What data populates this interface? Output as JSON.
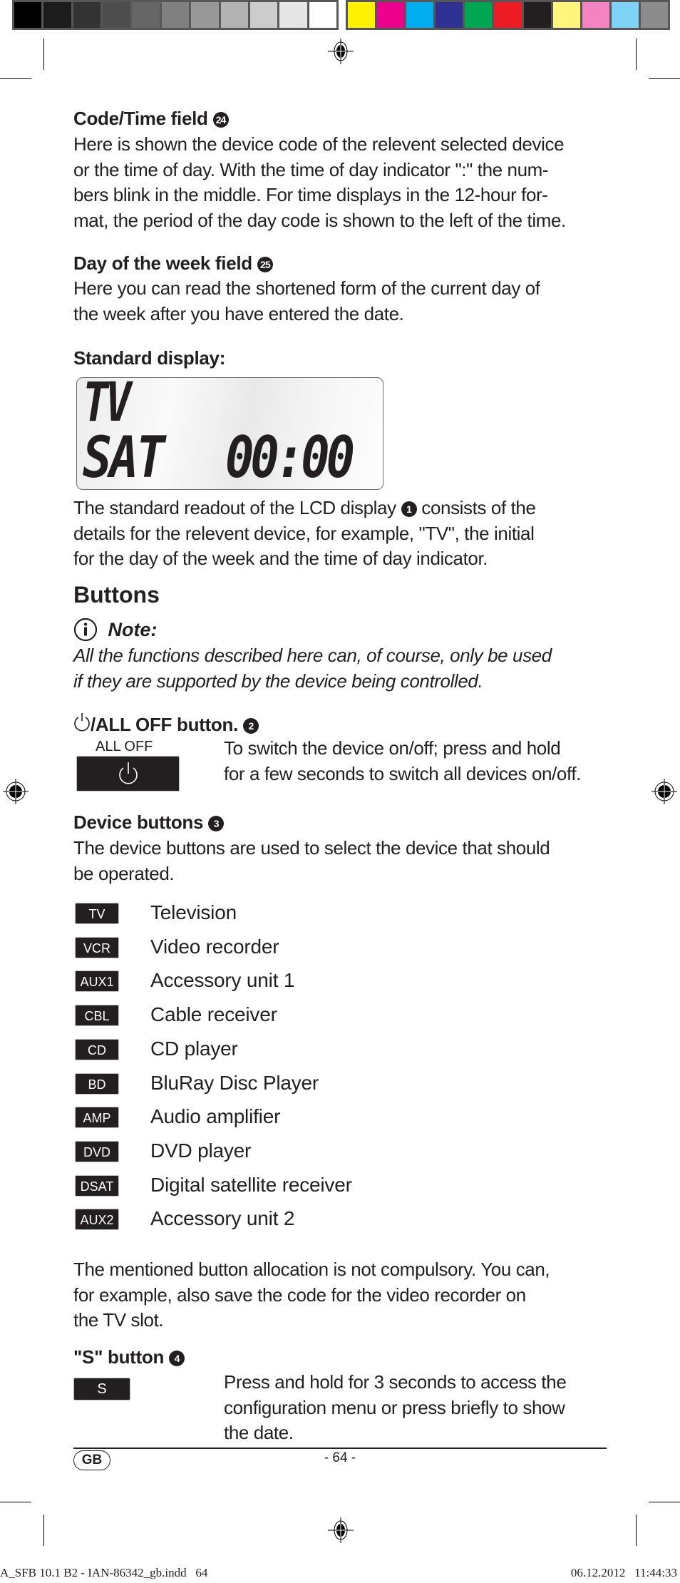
{
  "print_marks": {
    "grayscale_swatches": [
      "#000000",
      "#1c1c1c",
      "#333333",
      "#4d4d4d",
      "#666666",
      "#808080",
      "#999999",
      "#b3b3b3",
      "#cccccc",
      "#e6e6e6",
      "#ffffff"
    ],
    "color_swatches": [
      "#fff200",
      "#ec008c",
      "#00aeef",
      "#2e3192",
      "#00a651",
      "#ed1c24",
      "#231f20",
      "#fff57d",
      "#f383c1",
      "#7fd3f7",
      "#8c8c8c"
    ]
  },
  "sections": {
    "code_time": {
      "heading": "Code/Time field",
      "ref": "24",
      "lines": [
        "Here is shown the device code of the relevent selected device",
        "or the time of day. With the time of day indicator \":\" the num-",
        "bers blink in the middle. For time displays in the 12-hour for-",
        "mat, the period of the day code is shown to the left of the time."
      ]
    },
    "day_of_week": {
      "heading": "Day of the week field",
      "ref": "25",
      "lines": [
        "Here you can read the shortened form of the current day of",
        "the week after you have entered the date."
      ]
    },
    "standard_display": {
      "heading": "Standard display:",
      "lcd": {
        "device": "TV",
        "day": "SAT",
        "time": "00:00"
      },
      "lines_before_ref": "The standard readout of the LCD display",
      "ref": "1",
      "lines": [
        "consists of the",
        "details for the relevent device, for example, \"TV\", the initial",
        "for the day of the week and the time of day indicator."
      ]
    },
    "buttons": {
      "heading": "Buttons",
      "note": {
        "icon": "info-icon",
        "title": "Note:",
        "lines": [
          "All the functions described here can, of course, only be used",
          "if they are supported by the device being controlled."
        ]
      },
      "all_off": {
        "heading": "/ALL OFF button.",
        "ref": "2",
        "key_label": "ALL OFF",
        "key_icon": "power-icon",
        "lines": [
          "To switch the device on/off; press and hold",
          "for a few seconds to switch all devices on/off."
        ]
      },
      "device_buttons": {
        "heading": "Device buttons",
        "ref": "3",
        "lines": [
          "The device buttons are used to select the device that should",
          "be operated."
        ],
        "items": [
          {
            "key": "TV",
            "label": "Television"
          },
          {
            "key": "VCR",
            "label": "Video recorder"
          },
          {
            "key": "AUX1",
            "label": "Accessory unit 1"
          },
          {
            "key": "CBL",
            "label": "Cable receiver"
          },
          {
            "key": "CD",
            "label": "CD player"
          },
          {
            "key": "BD",
            "label": "BluRay Disc Player"
          },
          {
            "key": "AMP",
            "label": "Audio amplifier"
          },
          {
            "key": "DVD",
            "label": "DVD player"
          },
          {
            "key": "DSAT",
            "label": "Digital satellite receiver"
          },
          {
            "key": "AUX2",
            "label": "Accessory unit 2"
          }
        ],
        "footnote_lines": [
          "The mentioned button allocation is not compulsory. You can,",
          "for example, also save the code for the video recorder on",
          "the TV slot."
        ]
      },
      "s_button": {
        "heading": "\"S\" button",
        "ref": "4",
        "key_label": "S",
        "lines": [
          "Press and hold for 3 seconds to access the",
          "configuration menu or press briefly to show",
          "the date."
        ]
      }
    }
  },
  "footer": {
    "language_badge": "GB",
    "page_number": "- 64 -",
    "slug_left": "A_SFB 10.1 B2 - IAN-86342_gb.indd   64",
    "slug_right": "06.12.2012   11:44:33"
  }
}
